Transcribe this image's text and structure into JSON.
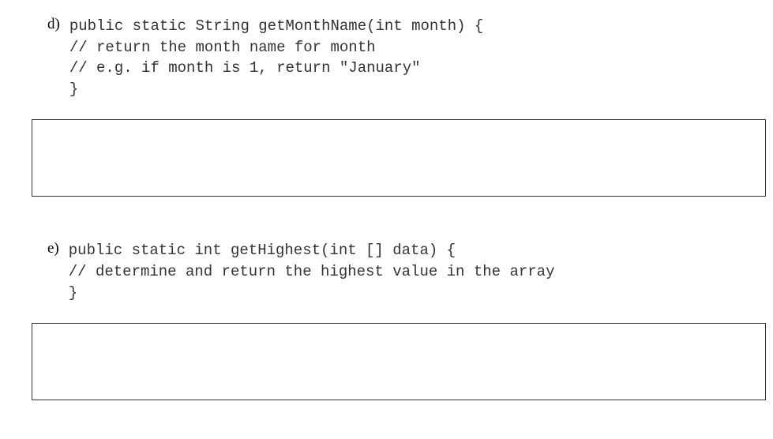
{
  "questions": [
    {
      "label": "d)",
      "code": "public static String getMonthName(int month) {\n// return the month name for month\n// e.g. if month is 1, return \"January\"\n}"
    },
    {
      "label": "e)",
      "code": "public static int getHighest(int [] data) {\n// determine and return the highest value in the array\n}"
    }
  ]
}
